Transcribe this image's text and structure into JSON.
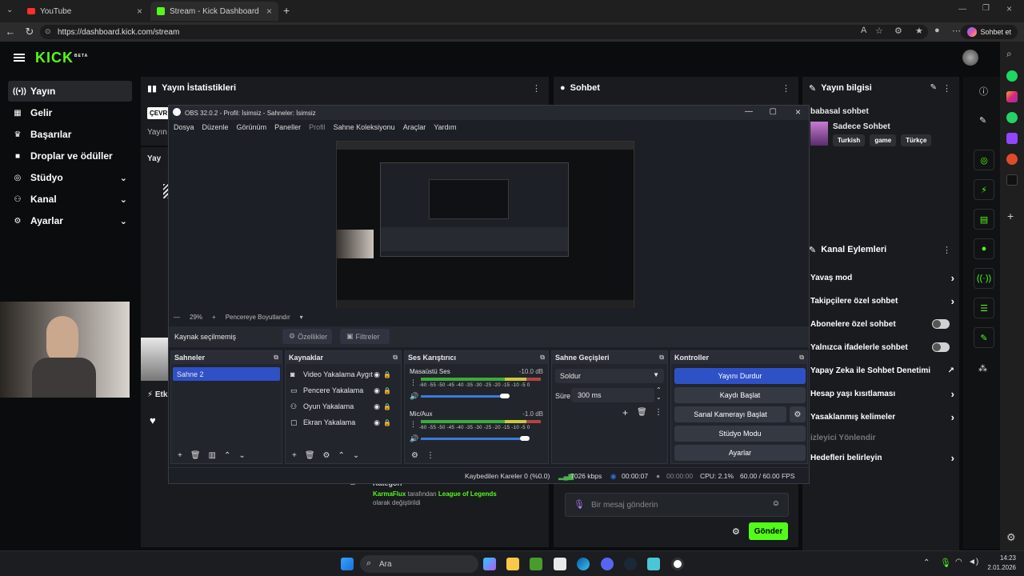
{
  "browser": {
    "tabs": [
      {
        "title": "YouTube"
      },
      {
        "title": "Stream - Kick Dashboard"
      }
    ],
    "url": "https://dashboard.kick.com/stream",
    "copilot_label": "Sohbet et"
  },
  "kick": {
    "logo": "KICK",
    "logo_badge": "BETA",
    "sidebar": [
      {
        "label": "Yayın",
        "icon": "broadcast-icon"
      },
      {
        "label": "Gelir",
        "icon": "revenue-icon"
      },
      {
        "label": "Başarılar",
        "icon": "trophy-icon"
      },
      {
        "label": "Droplar ve ödüller",
        "icon": "gift-icon"
      },
      {
        "label": "Stüdyo",
        "icon": "studio-icon"
      },
      {
        "label": "Kanal",
        "icon": "channel-icon"
      },
      {
        "label": "Ayarlar",
        "icon": "gear-icon"
      }
    ],
    "panels": {
      "stats_title": "Yayın İstatistikleri",
      "stats_badge": "ÇEVR",
      "stats_sub": "Yayın",
      "stats_second_title": "Yay",
      "activity_title": "Etk",
      "chat_title": "Sohbet",
      "info_title": "Yayın bilgisi",
      "actions_title": "Kanal Eylemleri"
    },
    "info": {
      "title": "babasal sohbet",
      "category": "Sadece Sohbet",
      "tags": [
        "Turkish",
        "game",
        "Türkçe"
      ]
    },
    "actions": [
      {
        "label": "Yavaş mod",
        "control": "chevron"
      },
      {
        "label": "Takipçilere özel sohbet",
        "control": "chevron"
      },
      {
        "label": "Abonelere özel sohbet",
        "control": "toggle"
      },
      {
        "label": "Yalnızca ifadelerle sohbet",
        "control": "toggle"
      },
      {
        "label": "Yapay Zeka ile Sohbet Denetimi",
        "control": "external"
      },
      {
        "label": "Hesap yaşı kısıtlaması",
        "control": "chevron"
      },
      {
        "label": "Yasaklanmış kelimeler",
        "control": "chevron"
      },
      {
        "label": "izleyici Yönlendir",
        "control": "none"
      },
      {
        "label": "Hedefleri belirleyin",
        "control": "chevron"
      }
    ],
    "feed": {
      "label": "Kategori",
      "user": "KarmaFlux",
      "middle": "tarafından",
      "game": "League of Legends",
      "suffix": "olarak değiştirildi"
    },
    "chat": {
      "placeholder": "Bir mesaj gönderin",
      "send": "Gönder"
    }
  },
  "obs": {
    "title": "OBS 32.0.2 - Profil: İsimsiz - Sahneler: İsimsiz",
    "menu": [
      "Dosya",
      "Düzenle",
      "Görünüm",
      "Paneller",
      "Profil",
      "Sahne Koleksiyonu",
      "Araçlar",
      "Yardım"
    ],
    "zoom": "29%",
    "fit_label": "Pencereye Boyutlandır",
    "no_source": "Kaynak seçilmemiş",
    "properties": "Özellikler",
    "filters": "Filtreler",
    "docks": {
      "scenes": "Sahneler",
      "sources": "Kaynaklar",
      "mixer": "Ses Karıştırıcı",
      "transitions": "Sahne Geçişleri",
      "controls": "Kontroller"
    },
    "scenes": [
      "Sahne 2"
    ],
    "sources": [
      {
        "label": "Video Yakalama Aygıt",
        "icon": "camera-icon"
      },
      {
        "label": "Pencere Yakalama",
        "icon": "window-icon"
      },
      {
        "label": "Oyun Yakalama",
        "icon": "gamepad-icon"
      },
      {
        "label": "Ekran Yakalama",
        "icon": "monitor-icon"
      }
    ],
    "mixer": [
      {
        "name": "Masaüstü Ses",
        "db": "-10.0 dB",
        "level": 0.75
      },
      {
        "name": "Mic/Aux",
        "db": "-1.0 dB",
        "level": 0.93
      }
    ],
    "meter_scale": "-60 -55 -50 -45 -40 -35 -30 -25 -20 -15 -10 -5 0",
    "transitions": {
      "type": "Soldur",
      "duration_label": "Süre",
      "duration_value": "300 ms"
    },
    "controls": [
      "Yayını Durdur",
      "Kaydı Başlat",
      "Sanal Kamerayı Başlat",
      "Stüdyo Modu",
      "Ayarlar"
    ],
    "status": {
      "dropped": "Kaybedilen Kareler 0 (%0.0)",
      "bitrate": "7026 kbps",
      "stream_time": "00:00:07",
      "rec_time": "00:00:00",
      "cpu": "CPU: 2.1%",
      "fps": "60.00 / 60.00 FPS"
    }
  },
  "taskbar": {
    "search": "Ara",
    "time": "14:23",
    "date": "2.01.2026"
  },
  "colors": {
    "kick_green": "#53fc18",
    "obs_active_blue": "#2f51c6",
    "stop_stream_blue": "#2f51c6"
  }
}
